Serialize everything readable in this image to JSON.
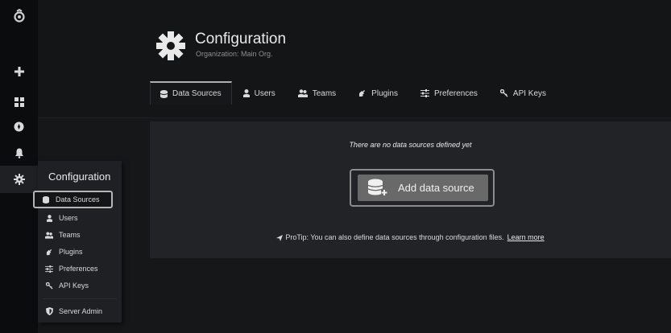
{
  "rail": {
    "items": [
      {
        "icon": "grafana-logo-icon"
      },
      {
        "icon": "plus-icon"
      },
      {
        "icon": "dashboards-icon"
      },
      {
        "icon": "explore-compass-icon"
      },
      {
        "icon": "alerting-bell-icon"
      },
      {
        "icon": "gear-icon"
      }
    ]
  },
  "header": {
    "title": "Configuration",
    "subtitle": "Organization: Main Org."
  },
  "tabs": [
    {
      "label": "Data Sources",
      "icon": "database-icon",
      "active": true
    },
    {
      "label": "Users",
      "icon": "user-icon"
    },
    {
      "label": "Teams",
      "icon": "users-icon"
    },
    {
      "label": "Plugins",
      "icon": "plug-icon"
    },
    {
      "label": "Preferences",
      "icon": "sliders-icon"
    },
    {
      "label": "API Keys",
      "icon": "key-icon"
    }
  ],
  "empty_state": {
    "message": "There are no data sources defined yet",
    "button_label": "Add data source",
    "protip_text": "ProTip: You can also define data sources through configuration files.",
    "learn_more": "Learn more"
  },
  "flyout": {
    "title": "Configuration",
    "items": [
      {
        "label": "Data Sources",
        "icon": "database-icon",
        "active": true
      },
      {
        "label": "Users",
        "icon": "user-icon"
      },
      {
        "label": "Teams",
        "icon": "users-icon"
      },
      {
        "label": "Plugins",
        "icon": "plug-icon"
      },
      {
        "label": "Preferences",
        "icon": "sliders-icon"
      },
      {
        "label": "API Keys",
        "icon": "key-icon"
      }
    ],
    "server_admin_label": "Server Admin"
  },
  "colors": {
    "background": "#161719",
    "rail": "#0b0c0e",
    "panel": "#222326",
    "button": "#696969"
  }
}
